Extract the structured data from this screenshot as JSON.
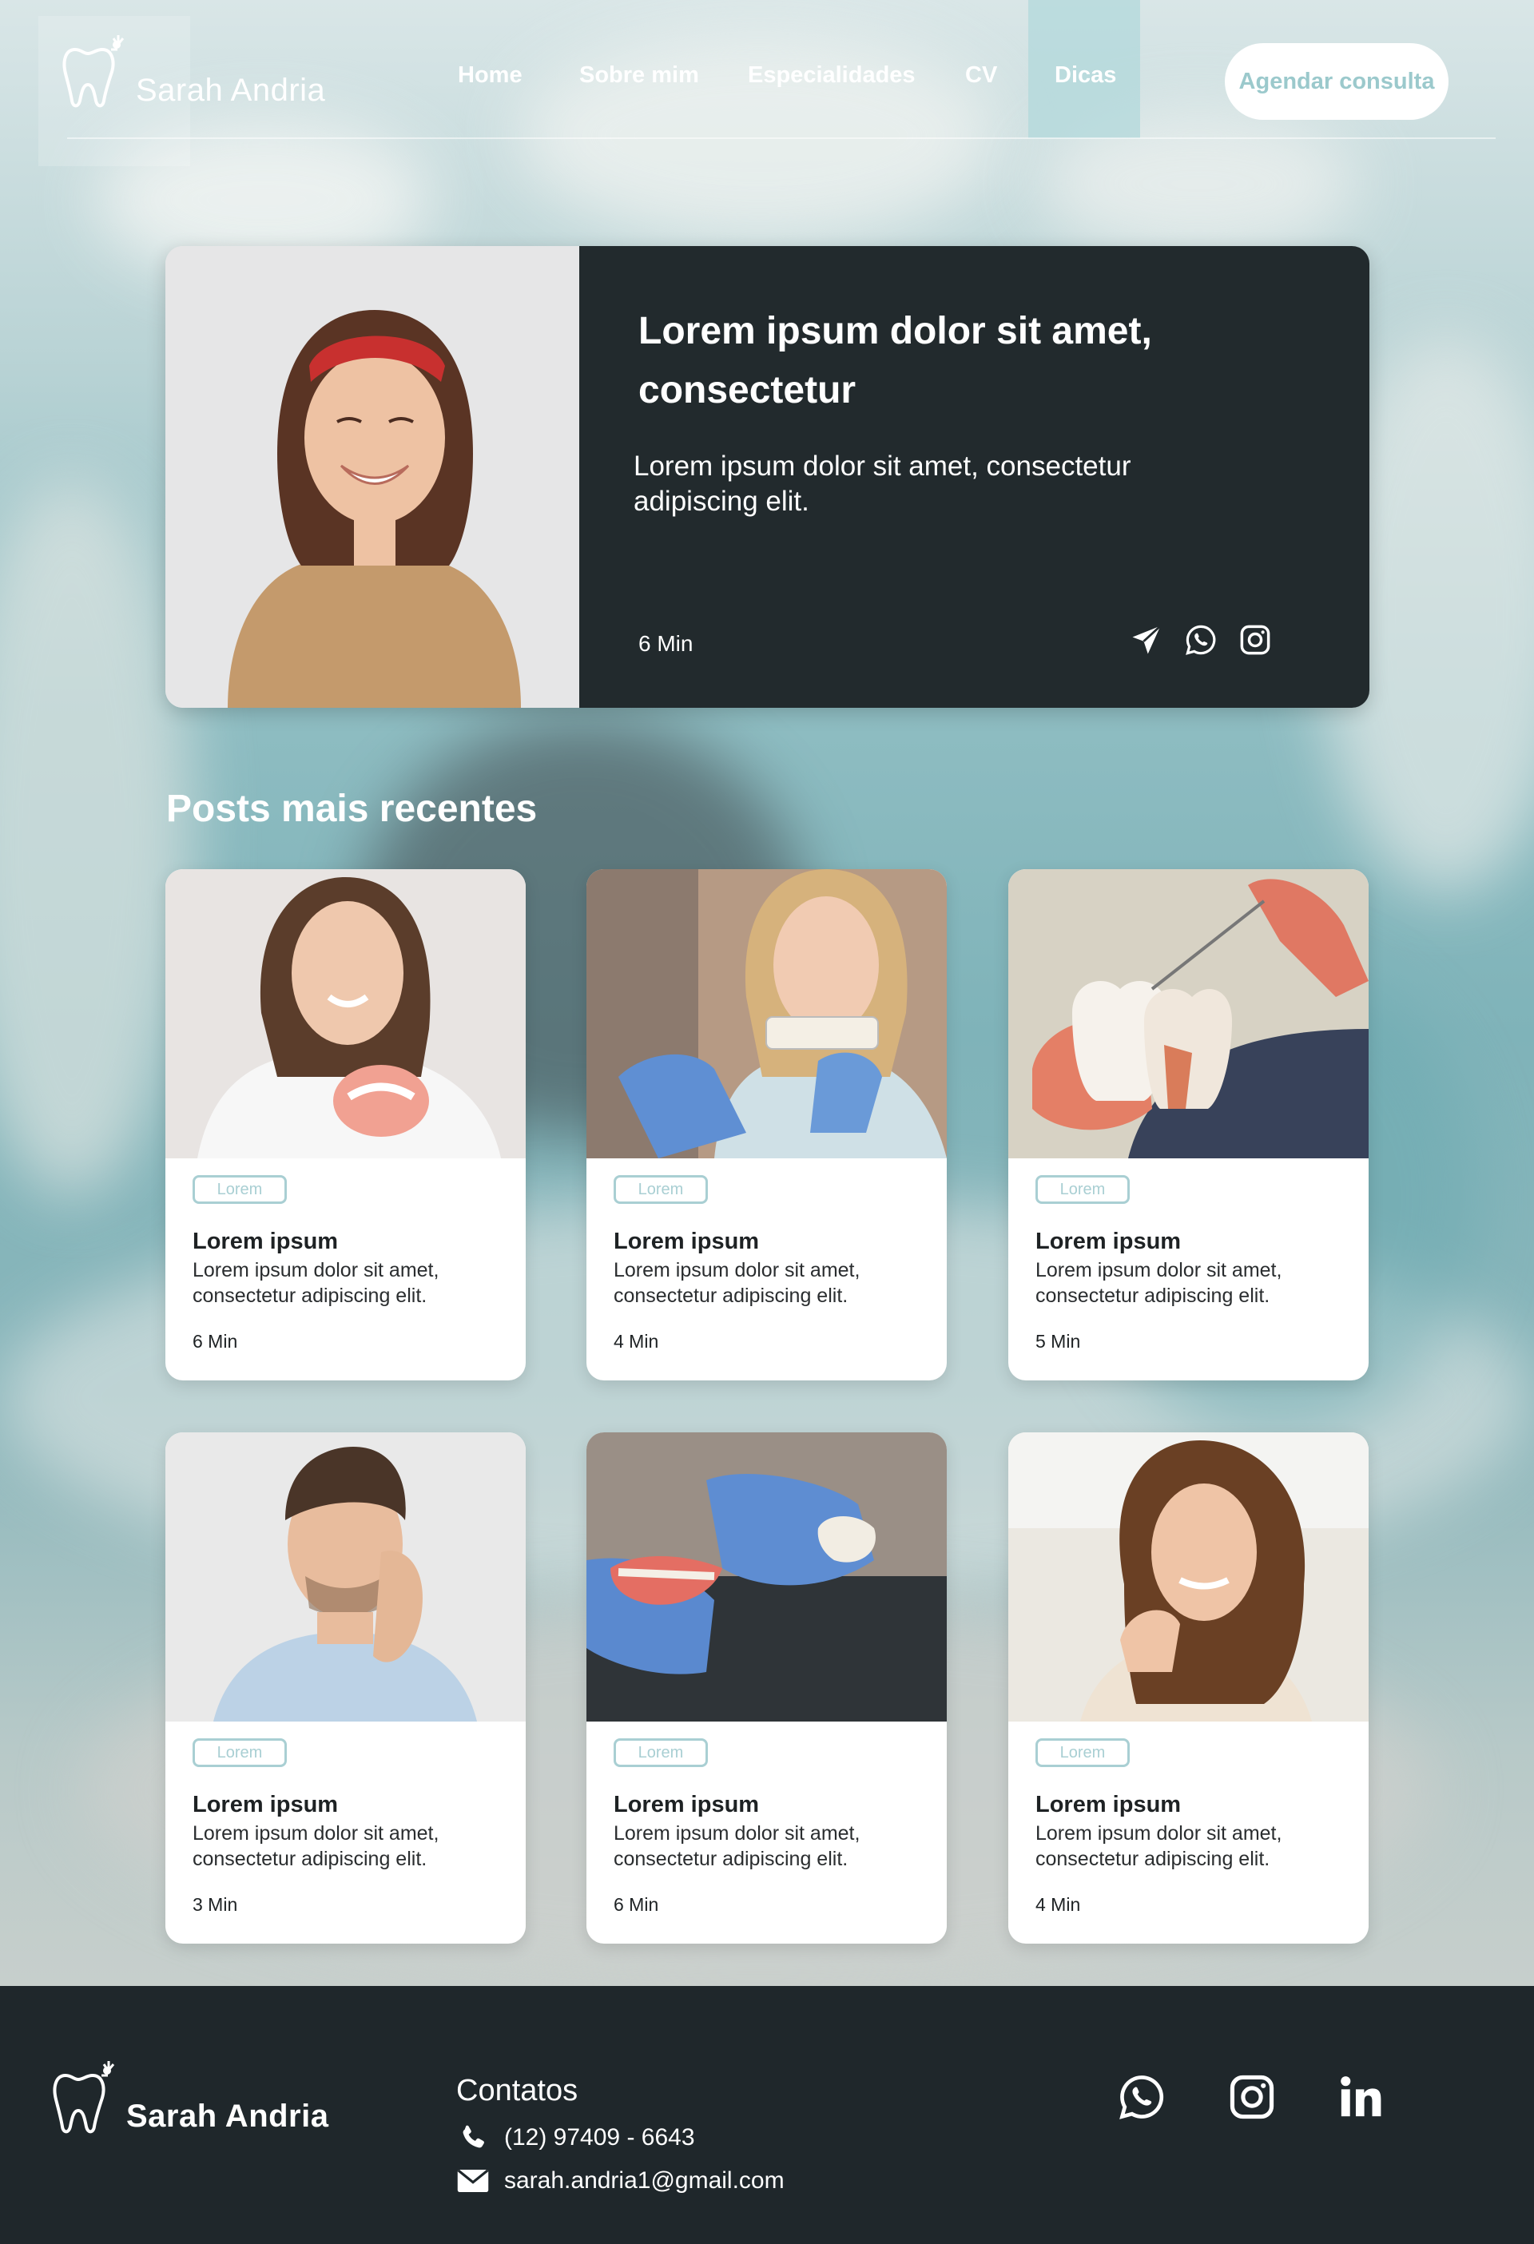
{
  "brand": {
    "name": "Sarah Andria"
  },
  "nav": {
    "items": [
      "Home",
      "Sobre mim",
      "Especialidades",
      "CV",
      "Dicas"
    ],
    "active": "Dicas",
    "cta": "Agendar consulta"
  },
  "featured": {
    "title": "Lorem ipsum dolor sit amet, consectetur",
    "description": "Lorem ipsum dolor sit amet, consectetur adipiscing elit.",
    "read_time": "6 Min",
    "share_icons": [
      "send-icon",
      "whatsapp-icon",
      "instagram-icon"
    ]
  },
  "recent": {
    "title": "Posts mais recentes",
    "posts": [
      {
        "tag": "Lorem",
        "title": "Lorem ipsum",
        "description": "Lorem ipsum dolor sit amet, consectetur adipiscing elit.",
        "read_time": "6 Min"
      },
      {
        "tag": "Lorem",
        "title": "Lorem ipsum",
        "description": "Lorem ipsum dolor sit amet, consectetur adipiscing elit.",
        "read_time": "4 Min"
      },
      {
        "tag": "Lorem",
        "title": "Lorem ipsum",
        "description": "Lorem ipsum dolor sit amet, consectetur adipiscing elit.",
        "read_time": "5 Min"
      },
      {
        "tag": "Lorem",
        "title": "Lorem ipsum",
        "description": "Lorem ipsum dolor sit amet, consectetur adipiscing elit.",
        "read_time": "3 Min"
      },
      {
        "tag": "Lorem",
        "title": "Lorem ipsum",
        "description": "Lorem ipsum dolor sit amet, consectetur adipiscing elit.",
        "read_time": "6 Min"
      },
      {
        "tag": "Lorem",
        "title": "Lorem ipsum",
        "description": "Lorem ipsum dolor sit amet, consectetur adipiscing elit.",
        "read_time": "4 Min"
      }
    ]
  },
  "footer": {
    "brand": "Sarah Andria",
    "contacts_title": "Contatos",
    "phone": "(12) 97409 - 6643",
    "email": "sarah.andria1@gmail.com",
    "social_icons": [
      "whatsapp-icon",
      "instagram-icon",
      "linkedin-icon"
    ]
  },
  "colors": {
    "dark": "#222a2d",
    "accent": "#a9cfd3",
    "nav_active": "#b2d8db"
  }
}
